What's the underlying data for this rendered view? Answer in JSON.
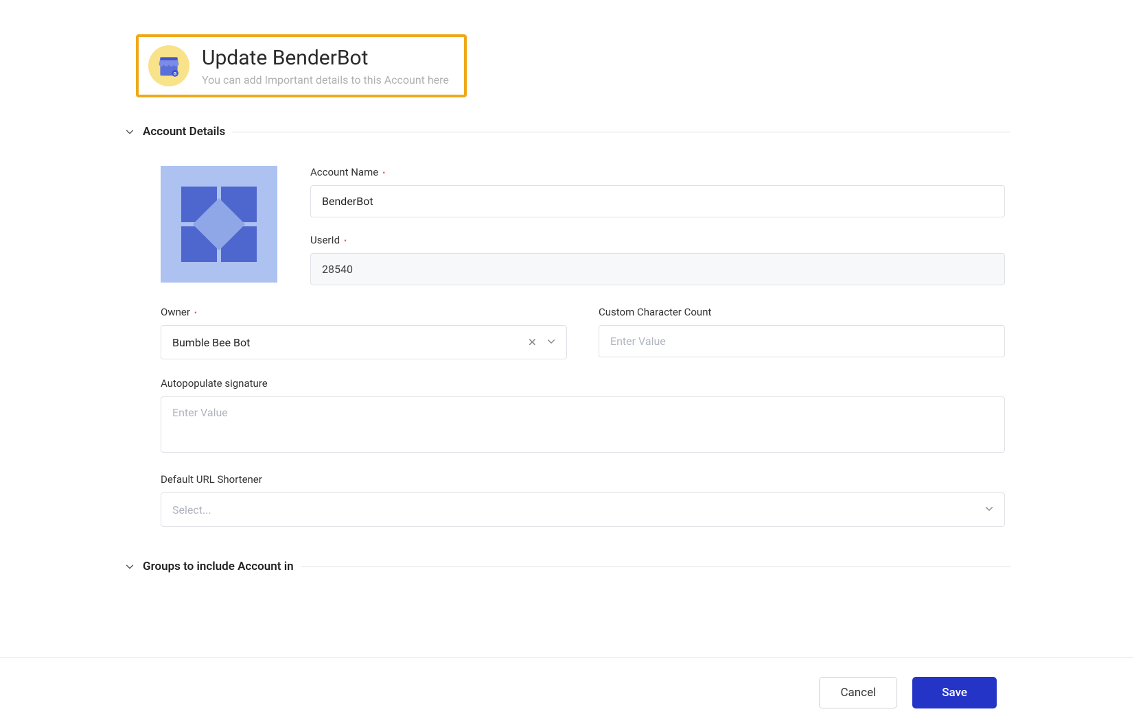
{
  "header": {
    "title": "Update BenderBot",
    "subtitle": "You can add Important details to this Account here"
  },
  "sections": {
    "accountDetails": {
      "title": "Account Details"
    },
    "groups": {
      "title": "Groups to include Account in"
    }
  },
  "fields": {
    "accountName": {
      "label": "Account Name",
      "value": "BenderBot"
    },
    "userId": {
      "label": "UserId",
      "value": "28540"
    },
    "owner": {
      "label": "Owner",
      "value": "Bumble Bee Bot"
    },
    "customCharCount": {
      "label": "Custom Character Count",
      "placeholder": "Enter Value"
    },
    "autoSignature": {
      "label": "Autopopulate signature",
      "placeholder": "Enter Value"
    },
    "urlShortener": {
      "label": "Default URL Shortener",
      "placeholder": "Select..."
    }
  },
  "footer": {
    "cancel": "Cancel",
    "save": "Save"
  }
}
